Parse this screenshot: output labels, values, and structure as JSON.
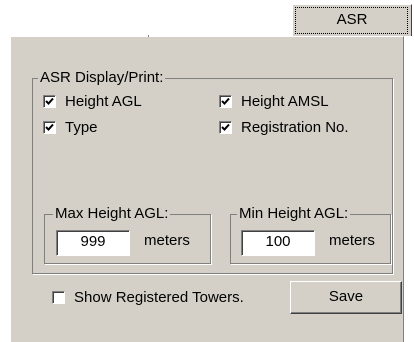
{
  "tab": {
    "label": "ASR"
  },
  "display_group": {
    "legend": "ASR Display/Print:",
    "checkboxes": [
      {
        "label": "Height AGL",
        "checked": true
      },
      {
        "label": "Height AMSL",
        "checked": true
      },
      {
        "label": "Type",
        "checked": true
      },
      {
        "label": "Registration No.",
        "checked": true
      }
    ]
  },
  "max_height": {
    "legend": "Max Height AGL:",
    "value": "999",
    "unit": "meters"
  },
  "min_height": {
    "legend": "Min Height AGL:",
    "value": "100",
    "unit": "meters"
  },
  "show_registered": {
    "label": "Show Registered Towers.",
    "checked": false
  },
  "save_button": {
    "label": "Save"
  }
}
